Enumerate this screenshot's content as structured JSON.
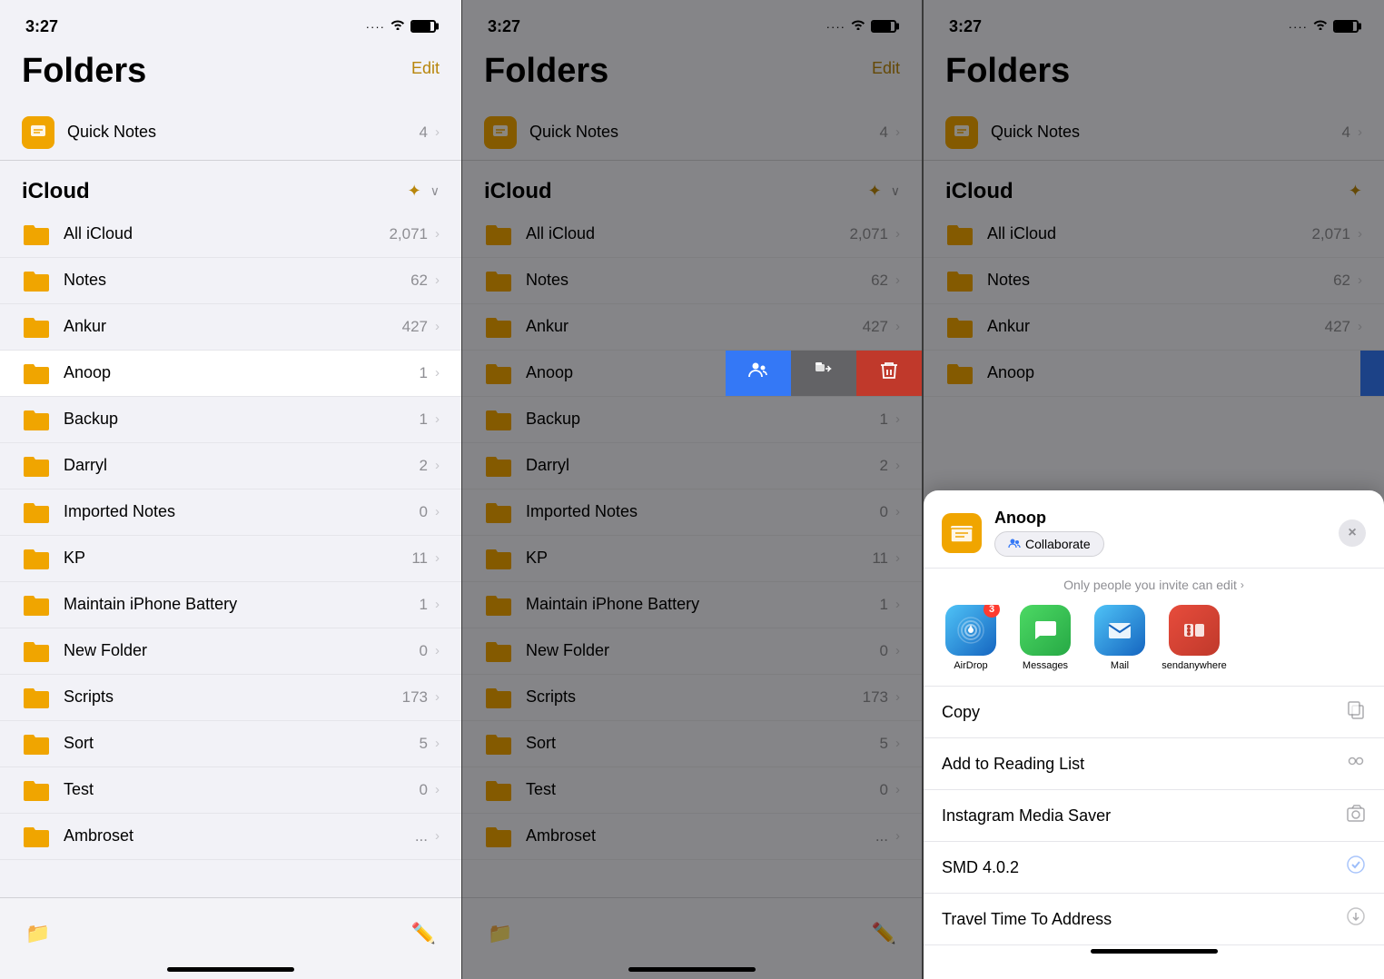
{
  "panels": [
    {
      "id": "panel1",
      "status": {
        "time": "3:27",
        "signal": ".....",
        "wifi": "wifi",
        "battery": "full"
      },
      "edit_label": "Edit",
      "folders_title": "Folders",
      "quick_notes": {
        "label": "Quick Notes",
        "count": "4"
      },
      "icloud_section": "iCloud",
      "folders": [
        {
          "name": "All iCloud",
          "count": "2,071"
        },
        {
          "name": "Notes",
          "count": "62"
        },
        {
          "name": "Ankur",
          "count": "427"
        },
        {
          "name": "Anoop",
          "count": "1",
          "selected": true
        },
        {
          "name": "Backup",
          "count": "1"
        },
        {
          "name": "Darryl",
          "count": "2"
        },
        {
          "name": "Imported Notes",
          "count": "0"
        },
        {
          "name": "KP",
          "count": "11"
        },
        {
          "name": "Maintain iPhone Battery",
          "count": "1"
        },
        {
          "name": "New Folder",
          "count": "0"
        },
        {
          "name": "Scripts",
          "count": "173"
        },
        {
          "name": "Sort",
          "count": "5"
        },
        {
          "name": "Test",
          "count": "0"
        },
        {
          "name": "Ambroset",
          "count": "..."
        }
      ]
    },
    {
      "id": "panel2",
      "status": {
        "time": "3:27"
      },
      "edit_label": "Edit",
      "action_buttons": [
        {
          "icon": "👥",
          "type": "collaborate"
        },
        {
          "icon": "📁",
          "type": "move"
        },
        {
          "icon": "🗑️",
          "type": "delete"
        }
      ]
    },
    {
      "id": "panel3",
      "status": {
        "time": "3:27"
      },
      "share_sheet": {
        "folder_name": "Anoop",
        "collaborate_label": "Collaborate",
        "invite_text": "Only people you invite can edit",
        "close_label": "×",
        "apps": [
          {
            "name": "AirDrop",
            "type": "airdrop",
            "badge": "3"
          },
          {
            "name": "Messages",
            "type": "messages",
            "badge": ""
          },
          {
            "name": "Mail",
            "type": "mail",
            "badge": ""
          },
          {
            "name": "sendanywhere",
            "type": "sendanywhere",
            "badge": ""
          }
        ],
        "actions": [
          {
            "label": "Copy",
            "icon": "📋"
          },
          {
            "label": "Add to Reading List",
            "icon": "👓"
          },
          {
            "label": "Instagram Media Saver",
            "icon": "📷"
          },
          {
            "label": "SMD 4.0.2",
            "icon": "✅"
          },
          {
            "label": "Travel Time To Address",
            "icon": "⬇"
          }
        ]
      }
    }
  ]
}
